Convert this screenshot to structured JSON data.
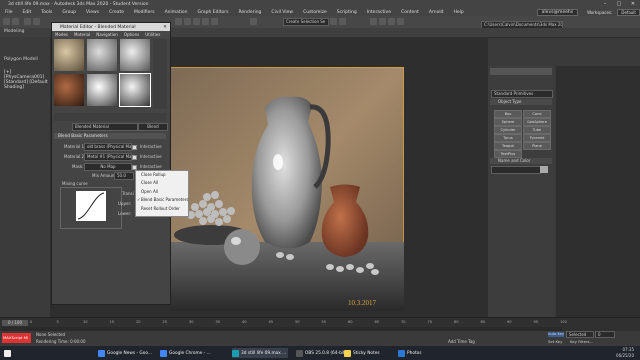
{
  "window": {
    "title": "3d still life 09.max - Autodesk 3ds Max 2020 - Student Version",
    "min": "–",
    "max": "□",
    "close": "✕"
  },
  "menubar": {
    "items": [
      "File",
      "Edit",
      "Tools",
      "Group",
      "Views",
      "Create",
      "Modifiers",
      "Animation",
      "Graph Editors",
      "Rendering",
      "Civil View",
      "Customize",
      "Scripting",
      "Interactive",
      "Content",
      "Arnold",
      "Help"
    ],
    "signin": "alevs@meehs",
    "workspaces": "Workspaces:",
    "workspace_value": "Default"
  },
  "toolbar": {
    "create_selection_set": "Create Selection Se",
    "path": "C:\\Users\\Calvin\\Documents\\3ds Max 2020"
  },
  "ribbon": {
    "tab1": "Modeling",
    "tab2": "Polygon Modeli"
  },
  "viewport": {
    "label": "[+] [PhysCamera001] [Standard] [Default Shading]",
    "signature": "10.3.2017"
  },
  "material_editor": {
    "title": "Material Editor - Blended Material",
    "menu": [
      "Modes",
      "Material",
      "Navigation",
      "Options",
      "Utilities"
    ],
    "material_name": "Blended Material",
    "material_type": "Blend",
    "rollout_title": "Blend Basic Parameters",
    "material1_label": "Material 1:",
    "material1_value": "old brass (Physical Materi",
    "material2_label": "Material 2:",
    "material2_value": "Metal #1 (Physical Materi",
    "mask_label": "Mask:",
    "mask_value": "No Map",
    "interactive": "Interactive",
    "mix_amount_label": "Mix Amount:",
    "mix_amount_value": "50.0",
    "mixing_curve": "Mixing curve",
    "transition_zone": "Transi",
    "upper_label": "Upper:",
    "lower_label": "Lower:"
  },
  "context_menu": {
    "items": [
      "Close Rollup",
      "Close All",
      "Open All",
      "Blend Basic Parameters",
      "Reset Rollout Order"
    ]
  },
  "command_panel": {
    "dropdown": "Standard Primitives",
    "object_type": "Object Type",
    "buttons": [
      "Box",
      "Cone",
      "Sphere",
      "GeoSphere",
      "Cylinder",
      "Tube",
      "Torus",
      "Pyramid",
      "Teapot",
      "Plane",
      "TextPlus"
    ],
    "name_color": "Name and Color"
  },
  "timeline": {
    "frame": "0 / 100",
    "ticks": [
      "0",
      "5",
      "10",
      "15",
      "20",
      "25",
      "30",
      "35",
      "40",
      "45",
      "50",
      "55",
      "60",
      "65",
      "70",
      "75",
      "80",
      "85",
      "90",
      "95",
      "100"
    ]
  },
  "status": {
    "maxscript": "MAXScript Mi",
    "selected": "None Selected",
    "rendering_time": "Rendering Time: 0:00:00",
    "add_time_tag": "Add Time Tag",
    "auto_key": "Auto Key",
    "selected_dd": "Selected",
    "set_key": "Set Key",
    "key_filters": "Key Filters...",
    "frame_field": "0"
  },
  "taskbar": {
    "items": [
      "3d still life 09.max ...",
      "OBS 25.0.8 (64-bit, ...",
      "Sticky Notes",
      "Photos",
      "Google News - Goo...",
      "Google Chrome - ..."
    ],
    "time": "07:35",
    "date": "06/25/20"
  },
  "colors": {
    "accent": "#ff8a00",
    "viewport_border": "#d8a23a"
  }
}
